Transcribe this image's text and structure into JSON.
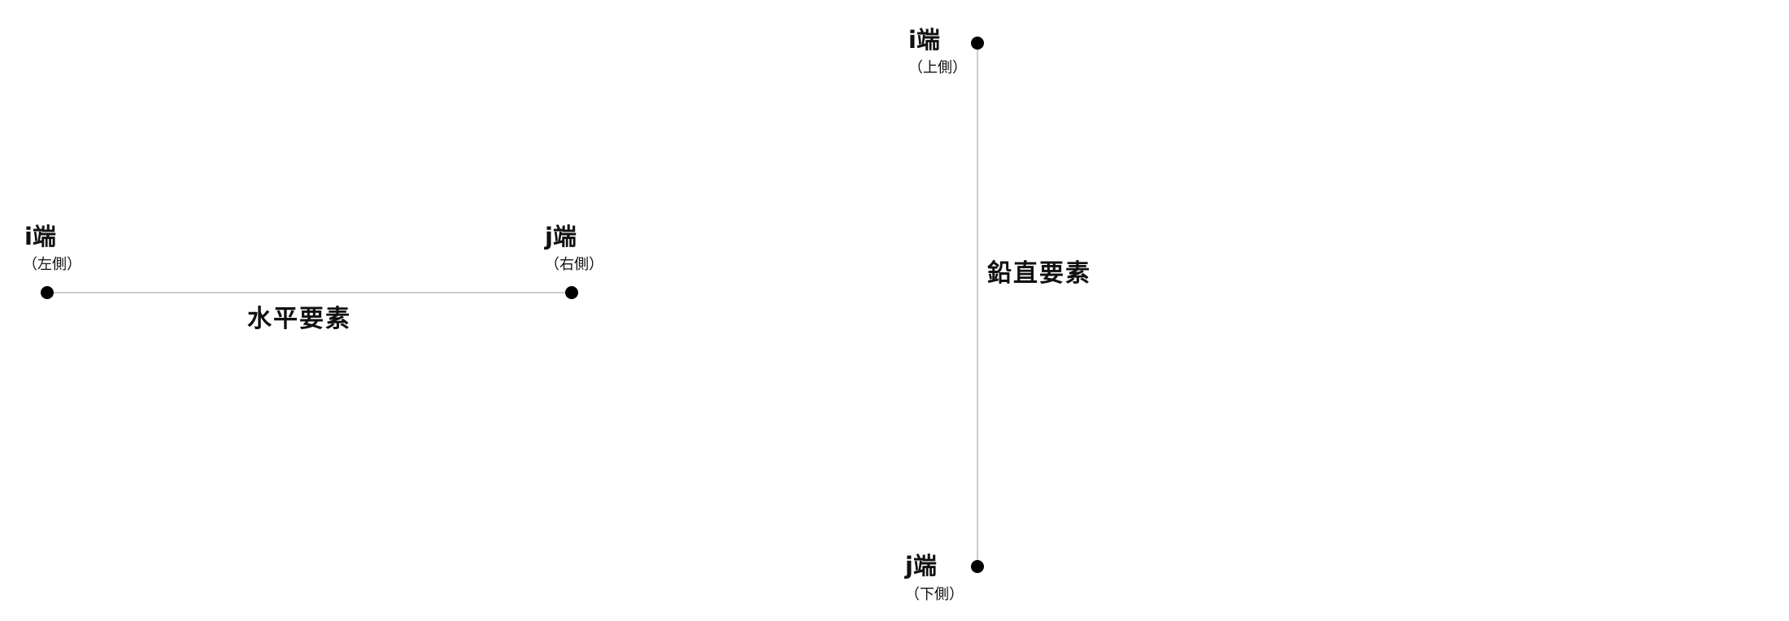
{
  "horizontal": {
    "i_end": "i端",
    "i_side": "（左側）",
    "j_end": "j端",
    "j_side": "（右側）",
    "member_name": "水平要素"
  },
  "vertical": {
    "i_end": "i端",
    "i_side": "（上側）",
    "j_end": "j端",
    "j_side": "（下側）",
    "member_name": "鉛直要素"
  },
  "colors": {
    "line": "#cccccc",
    "node": "#000000",
    "text": "#111111"
  }
}
